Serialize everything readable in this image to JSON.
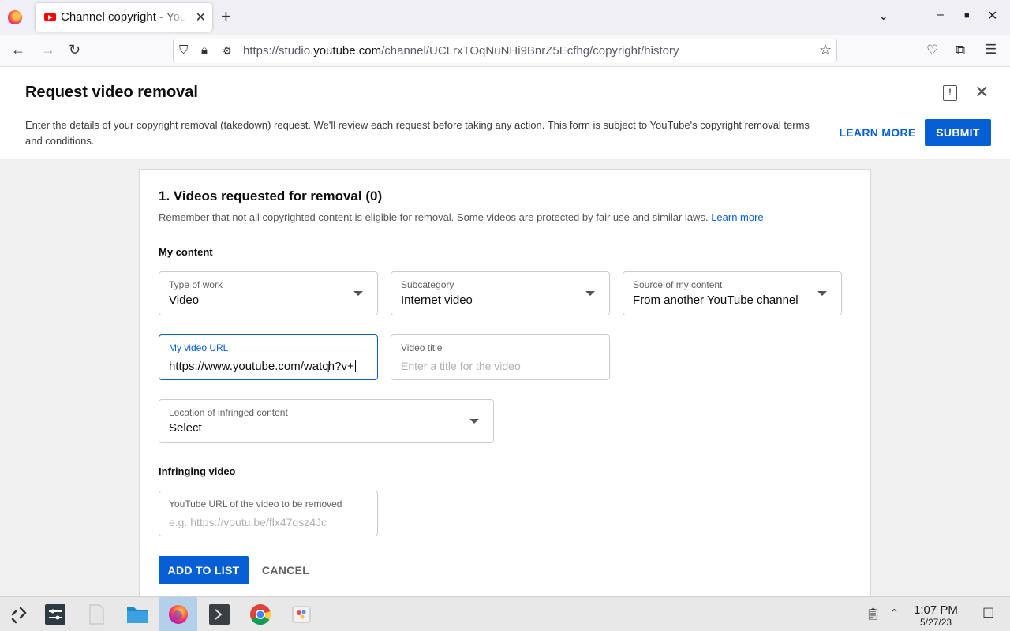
{
  "browser": {
    "tab_title": "Channel copyright - YouTube Studio",
    "tab_close": "✕",
    "new_tab": "+",
    "url_prefix": "https://studio.",
    "url_domain": "youtube.com",
    "url_path": "/channel/UCLrxTOqNuNHi9BnrZ5Ecfhg/copyright/history"
  },
  "header": {
    "title": "Request video removal",
    "description": "Enter the details of your copyright removal (takedown) request. We'll review each request before taking any action. This form is subject to YouTube's copyright removal terms and conditions.",
    "learn_more": "LEARN MORE",
    "submit": "SUBMIT",
    "feedback_glyph": "!",
    "close_glyph": "✕"
  },
  "form": {
    "section_title": "1. Videos requested for removal (0)",
    "section_desc": "Remember that not all copyrighted content is eligible for removal. Some videos are protected by fair use and similar laws.",
    "section_link": "Learn more",
    "my_content_label": "My content",
    "type_of_work": {
      "label": "Type of work",
      "value": "Video"
    },
    "subcategory": {
      "label": "Subcategory",
      "value": "Internet video"
    },
    "source": {
      "label": "Source of my content",
      "value": "From another YouTube channel"
    },
    "my_video_url": {
      "label": "My video URL",
      "value": "https://www.youtube.com/watch?v+"
    },
    "video_title": {
      "label": "Video title",
      "placeholder": "Enter a title for the video"
    },
    "location": {
      "label": "Location of infringed content",
      "value": "Select"
    },
    "infringing_label": "Infringing video",
    "infringing_url": {
      "label": "YouTube URL of the video to be removed",
      "placeholder": "e.g. https://youtu.be/flx47qsz4Jc"
    },
    "add_to_list": "ADD TO LIST",
    "cancel": "CANCEL"
  },
  "taskbar": {
    "time": "1:07 PM",
    "date": "5/27/23"
  },
  "colors": {
    "accent": "#065fd4",
    "youtube_red": "#ff0000"
  }
}
